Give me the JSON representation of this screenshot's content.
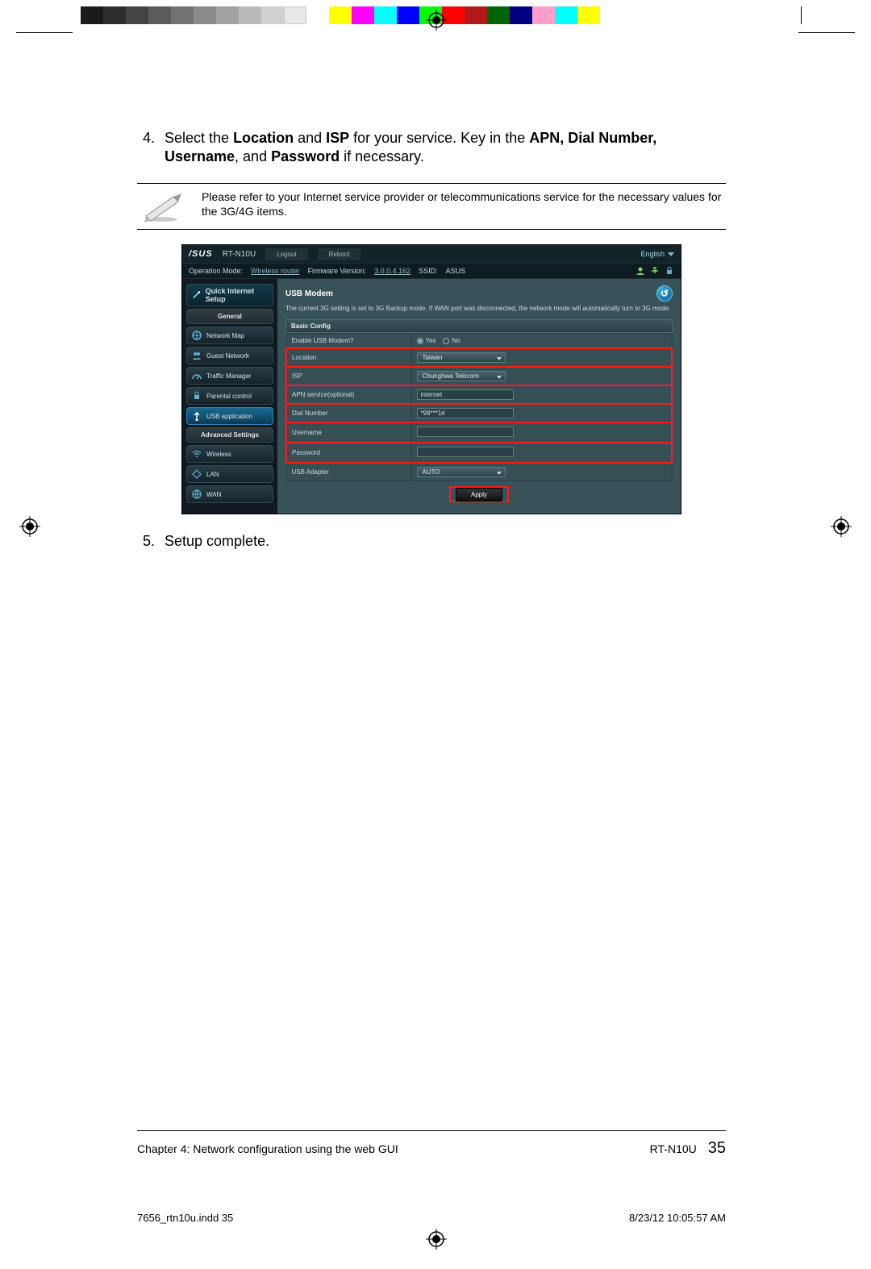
{
  "cal_colors": [
    "#1a1a1a",
    "#2e2e2e",
    "#444",
    "#5b5b5b",
    "#727272",
    "#8a8a8a",
    "#a1a1a1",
    "#b9b9b9",
    "#d0d0d0",
    "#e7e7e7",
    "#ffffff",
    "",
    "#ffff00",
    "#ff00ff",
    "#00ffff",
    "#0000ff",
    "#00ff00",
    "#ff0000",
    "#b01818",
    "#006400",
    "#000080",
    "#ff9ecb",
    "#00ffff",
    "#ffff00"
  ],
  "steps": {
    "four_num": "4.",
    "four_text": {
      "p1a": "Select the ",
      "b1": "Location",
      "p1b": " and ",
      "b2": "ISP",
      "p1c": " for your service. Key in the ",
      "b3": "APN, Dial Number, Username",
      "p1d": ", and ",
      "b4": "Password",
      "p1e": " if necessary."
    },
    "five_num": "5.",
    "five_text": "Setup complete."
  },
  "note": "Please refer to your Internet service provider or telecommunications service for the necessary values for the 3G/4G items.",
  "router": {
    "brand": "/SUS",
    "model": "RT-N10U",
    "logout": "Logout",
    "reboot": "Reboot",
    "language": "English",
    "status": {
      "opmode_label": "Operation Mode:",
      "opmode": "Wireless router",
      "fw_label": "Firmware Version:",
      "fw": "3.0.0.4.162",
      "ssid_label": "SSID:",
      "ssid": "ASUS"
    },
    "sidebar": {
      "qis": "Quick Internet Setup",
      "general": "General",
      "map": "Network Map",
      "guest": "Guest Network",
      "traffic": "Traffic Manager",
      "parental": "Parental control",
      "usb": "USB application",
      "adv": "Advanced Settings",
      "wireless": "Wireless",
      "lan": "LAN",
      "wan": "WAN"
    },
    "main": {
      "title": "USB Modem",
      "desc": "The current 3G setting is set to 3G Backup mode. If WAN port was disconnected, the network mode will automatically turn to 3G mode.",
      "config_head": "Basic Config",
      "rows": {
        "enable": {
          "label": "Enable USB Modem?",
          "yes": "Yes",
          "no": "No"
        },
        "location": {
          "label": "Location",
          "value": "Taiwan"
        },
        "isp": {
          "label": "ISP",
          "value": "Chunghwa Telecom"
        },
        "apn": {
          "label": "APN service(optional)",
          "value": "internet"
        },
        "dial": {
          "label": "Dial Number",
          "value": "*99***1#"
        },
        "user": {
          "label": "Username",
          "value": ""
        },
        "pass": {
          "label": "Password",
          "value": ""
        },
        "adapter": {
          "label": "USB Adapter",
          "value": "AUTO"
        }
      },
      "apply": "Apply"
    }
  },
  "footer": {
    "chapter": "Chapter 4: Network configuration using the web GUI",
    "model": "RT-N10U",
    "page": "35"
  },
  "slug": {
    "file": "7656_rtn10u.indd   35",
    "stamp": "8/23/12   10:05:57 AM"
  }
}
